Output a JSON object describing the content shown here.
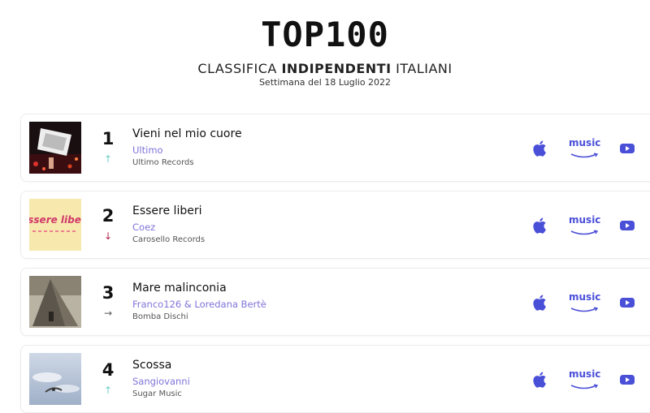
{
  "header": {
    "title": "TOP100",
    "subtitle_prefix": "CLASSIFICA ",
    "subtitle_bold": "INDIPENDENTI",
    "subtitle_suffix": " ITALIANI",
    "week": "Settimana del 18 Luglio 2022"
  },
  "icons": {
    "apple": "apple-music-icon",
    "amazon": "amazon-music-icon",
    "youtube": "youtube-icon",
    "amazon_text": "music",
    "accent_color": "#4a4fd8"
  },
  "entries": [
    {
      "rank": "1",
      "trend": "up",
      "trend_symbol": "↑",
      "song": "Vieni nel mio cuore",
      "artist": "Ultimo",
      "label": "Ultimo Records"
    },
    {
      "rank": "2",
      "trend": "down",
      "trend_symbol": "↓",
      "song": "Essere liberi",
      "artist": "Coez",
      "label": "Carosello Records",
      "cover_text": "Essere liberi"
    },
    {
      "rank": "3",
      "trend": "same",
      "trend_symbol": "→",
      "song": "Mare malinconia",
      "artist": "Franco126 & Loredana Bertè",
      "label": "Bomba Dischi"
    },
    {
      "rank": "4",
      "trend": "up",
      "trend_symbol": "↑",
      "song": "Scossa",
      "artist": "Sangiovanni",
      "label": "Sugar Music"
    }
  ]
}
